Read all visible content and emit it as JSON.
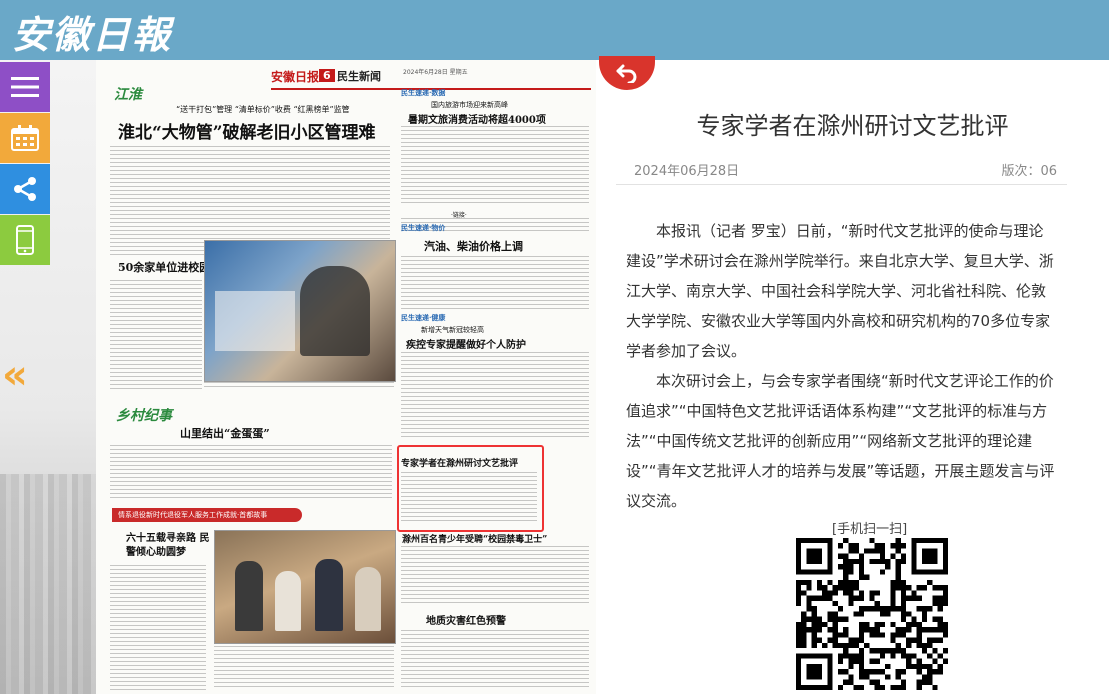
{
  "header": {
    "logo": "安徽日報"
  },
  "sidebar": {
    "buttons": [
      "menu-icon",
      "calendar-icon",
      "share-icon",
      "mobile-icon"
    ],
    "prev_page": "«"
  },
  "newspaper": {
    "name": "安徽日报",
    "page_number": "6",
    "section": "民生新闻",
    "edition_date": "2024年6月28日 星期五",
    "left_column_tag": "江淮",
    "headline_kicker": "“送干打包”管理 “清单标价”收费 “红黑榜单”监管",
    "headline_main": "淮北“大物管”破解老旧小区管理难",
    "right_column_tag1": "民生速递·数据",
    "right_headline1_kicker": "国内旅游市场迎来新高峰",
    "right_headline1": "暑期文旅消费活动将超4000项",
    "right_note": "·链接·",
    "right_column_tag2": "民生速递·物价",
    "right_headline2": "汽油、柴油价格上调",
    "right_column_tag3": "民生速递·健康",
    "right_headline3_kicker": "新增天气新冠较轻高",
    "right_headline3": "疾控专家提醒做好个人防护",
    "left_mid_headline": "50余家单位进校园",
    "left_mid_tag": "乡村纪事",
    "left_mid_headline2": "山里结出“金蛋蛋”",
    "highlighted_headline": "专家学者在滁州研讨文艺批评",
    "bottom_ribbon": "情系退役新时代退役军人服务工作成就·首都故事",
    "bottom_headline": "六十五载寻亲路 民警倾心助圆梦",
    "bottom_right_headline": "滁州百名青少年受聘“校园禁毒卫士”",
    "bottom_right_headline2": "地质灾害红色预警"
  },
  "article": {
    "title": "专家学者在滁州研讨文艺批评",
    "date": "2024年06月28日",
    "page": "版次：06",
    "paragraphs": [
      "本报讯（记者 罗宝）日前，“新时代文艺批评的使命与理论建设”学术研讨会在滁州学院举行。来自北京大学、复旦大学、浙江大学、南京大学、中国社会科学院大学、河北省社科院、伦敦大学学院、安徽农业大学等国内外高校和研究机构的70多位专家学者参加了会议。",
      "本次研讨会上，与会专家学者围绕“新时代文艺评论工作的价值追求”“中国特色文艺批评话语体系构建”“文艺批评的标准与方法”“中国传统文艺批评的创新应用”“网络新文艺批评的理论建设”“青年文艺批评人才的培养与发展”等话题，开展主题发言与评议交流。"
    ],
    "qr_label": "[手机扫一扫]"
  },
  "colors": {
    "header": "#6aa8c8",
    "accent_red": "#d9342c",
    "menu_btn": "#8e4fc6",
    "calendar_btn": "#f2a93b",
    "share_btn": "#2f8fe0",
    "mobile_btn": "#8ccb3f"
  }
}
